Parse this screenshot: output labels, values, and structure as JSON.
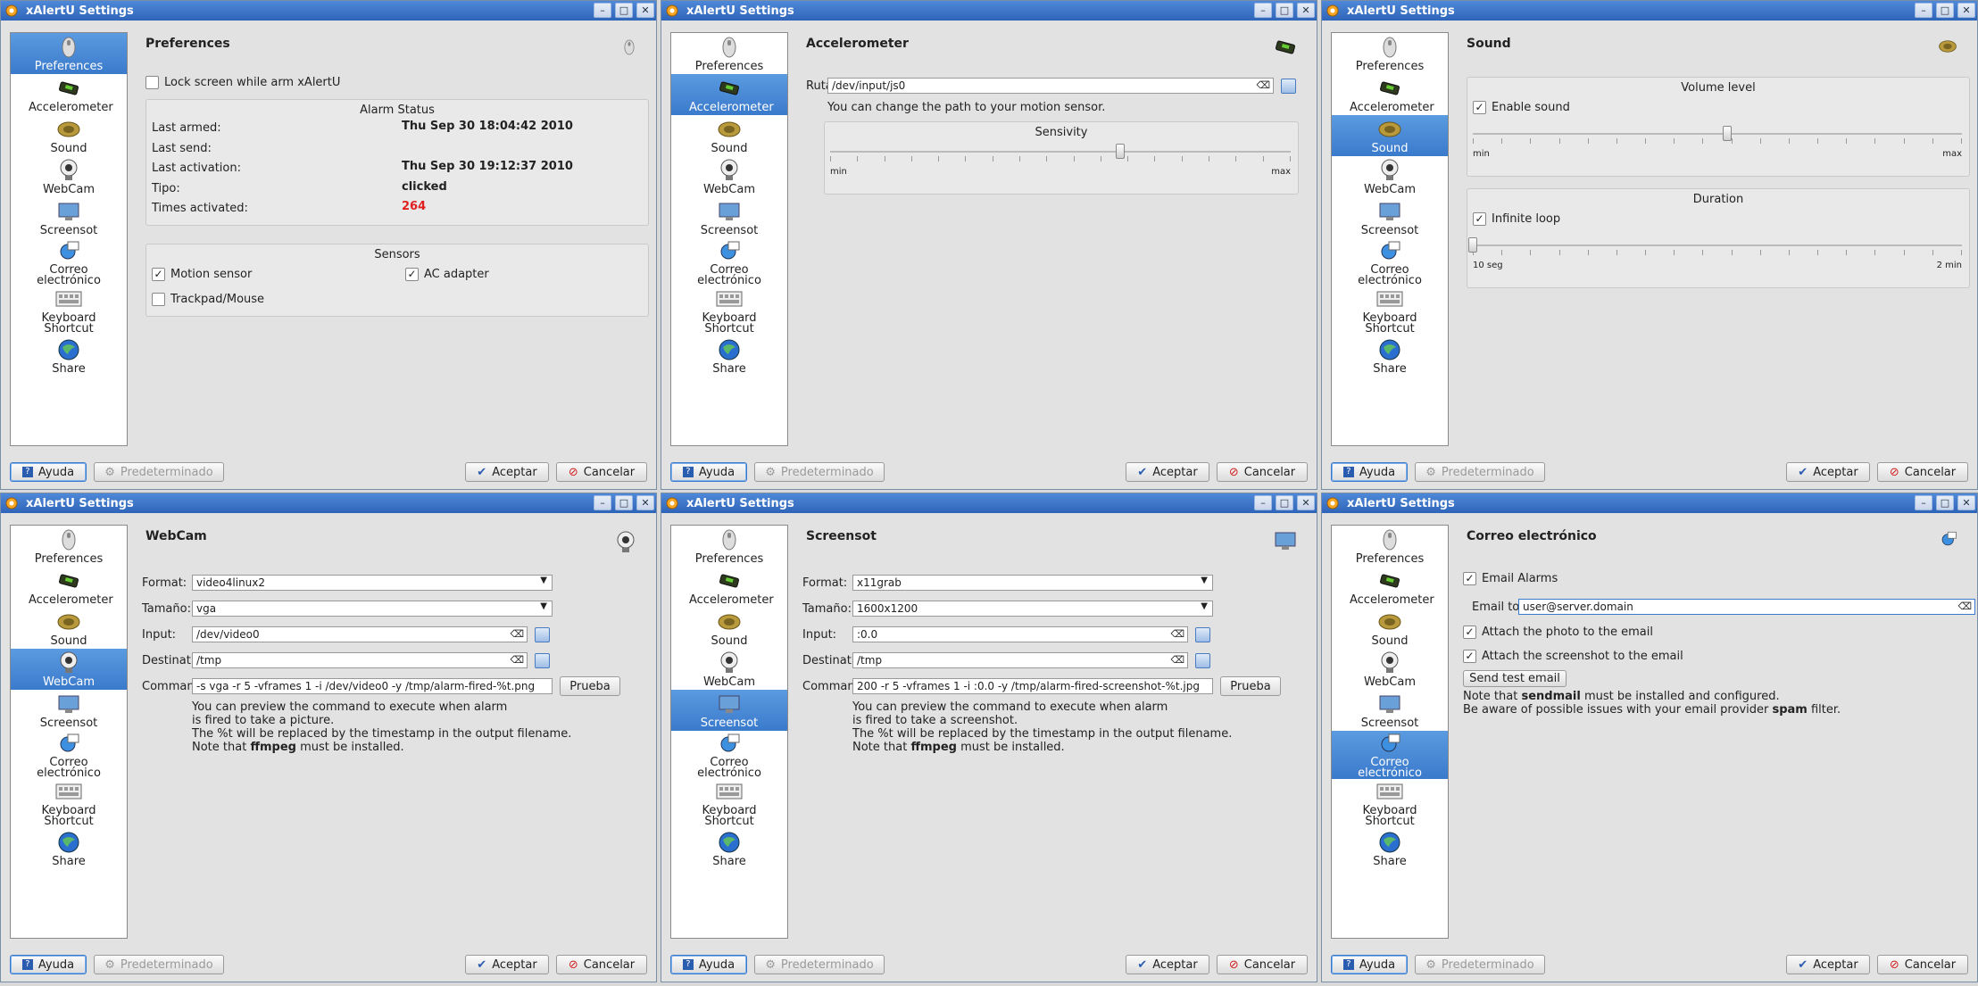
{
  "title": "xAlertU Settings",
  "sidebar_items": [
    "Preferences",
    "Accelerometer",
    "Sound",
    "WebCam",
    "Screensot",
    "Correo electrónico",
    "Keyboard Shortcut",
    "Share"
  ],
  "footer": {
    "help": "Ayuda",
    "defaults": "Predeterminado",
    "accept": "Aceptar",
    "cancel": "Cancelar"
  },
  "windows": {
    "preferences": {
      "heading": "Preferences",
      "lock_label": "Lock screen while arm xAlertU",
      "alarm_status_title": "Alarm Status",
      "alarm_rows": [
        {
          "label": "Last armed:",
          "value": "Thu Sep 30 18:04:42 2010"
        },
        {
          "label": "Last send:",
          "value": ""
        },
        {
          "label": "Last activation:",
          "value": "Thu Sep 30 19:12:37 2010"
        },
        {
          "label": "Tipo:",
          "value": "clicked"
        },
        {
          "label": "Times activated:",
          "value": "264"
        }
      ],
      "sensors_title": "Sensors",
      "motion_sensor": "Motion sensor",
      "ac_adapter": "AC adapter",
      "trackpad": "Trackpad/Mouse"
    },
    "accelerometer": {
      "heading": "Accelerometer",
      "ruta_label": "Ruta:",
      "ruta_value": "/dev/input/js0",
      "hint": "You can change the path to your motion sensor.",
      "sensivity_title": "Sensivity",
      "min": "min",
      "max": "max",
      "sensivity_fraction": 0.63
    },
    "sound": {
      "heading": "Sound",
      "volume_title": "Volume level",
      "enable_sound": "Enable sound",
      "min": "min",
      "max": "max",
      "volume_fraction": 0.52,
      "duration_title": "Duration",
      "infinite_loop": "Infinite loop",
      "dmin": "10 seg",
      "dmax": "2 min",
      "duration_fraction": 0.0
    },
    "webcam": {
      "heading": "WebCam",
      "format_label": "Format:",
      "format_value": "video4linux2",
      "size_label": "Tamaño:",
      "size_value": "vga",
      "input_label": "Input:",
      "input_value": "/dev/video0",
      "dest_label": "Destination:",
      "dest_value": "/tmp",
      "cmd_label": "Command:",
      "cmd_value": "-s vga -r 5 -vframes 1 -i /dev/video0 -y /tmp/alarm-fired-%t.png",
      "test": "Prueba",
      "note1": "You can preview the command to execute when alarm",
      "note2": "is fired to take a picture.",
      "note3": "The %t will be replaced by the timestamp in the output filename.",
      "note4a": "Note that ",
      "note4b": "ffmpeg",
      "note4c": " must be installed."
    },
    "screensot": {
      "heading": "Screensot",
      "format_label": "Format:",
      "format_value": "x11grab",
      "size_label": "Tamaño:",
      "size_value": "1600x1200",
      "input_label": "Input:",
      "input_value": ":0.0",
      "dest_label": "Destination:",
      "dest_value": "/tmp",
      "cmd_label": "Command:",
      "cmd_value": "200 -r 5 -vframes 1 -i :0.0 -y /tmp/alarm-fired-screenshot-%t.jpg",
      "test": "Prueba",
      "note1": "You can preview the command to execute when alarm",
      "note2": "is fired to take a screenshot.",
      "note3": "The %t will be replaced by the timestamp in the output filename.",
      "note4a": "Note that ",
      "note4b": "ffmpeg",
      "note4c": " must be installed."
    },
    "email": {
      "heading": "Correo electrónico",
      "email_alarms": "Email Alarms",
      "email_to_label": "Email to:",
      "email_to_value": "user@server.domain",
      "attach_photo": "Attach the photo to the email",
      "attach_screenshot": "Attach the screenshot to the email",
      "send_test": "Send test email",
      "note1a": "Note that ",
      "note1b": "sendmail",
      "note1c": " must be installed and configured.",
      "note2a": "Be aware of possible issues with your email provider ",
      "note2b": "spam",
      "note2c": " filter."
    }
  }
}
